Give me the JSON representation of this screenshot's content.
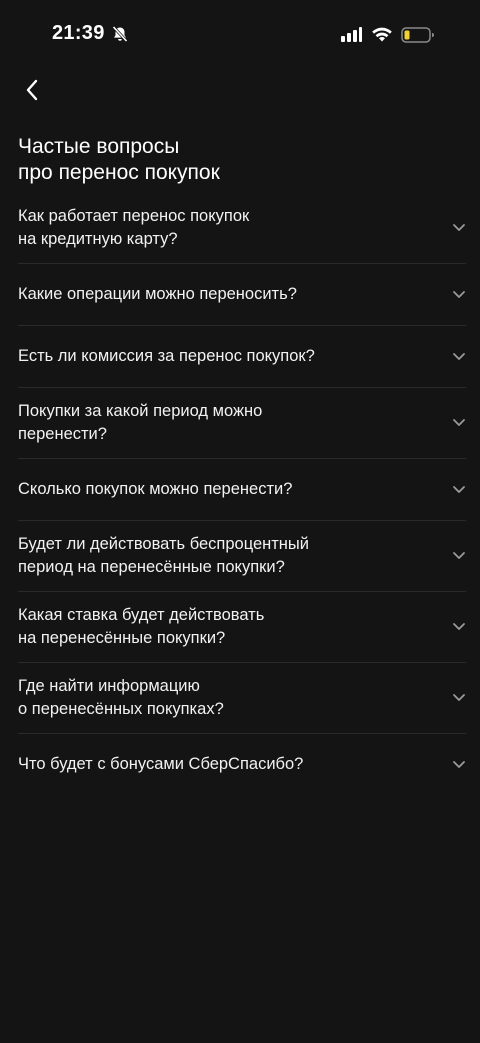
{
  "status_bar": {
    "time": "21:39"
  },
  "header": {
    "title": "Частые вопросы\nпро перенос покупок"
  },
  "faq": {
    "items": [
      {
        "question": "Как работает перенос покупок\nна кредитную карту?",
        "lines": 2
      },
      {
        "question": "Какие операции можно переносить?",
        "lines": 1
      },
      {
        "question": "Есть ли комиссия за перенос покупок?",
        "lines": 1
      },
      {
        "question": "Покупки за какой период можно\nперенести?",
        "lines": 2
      },
      {
        "question": "Сколько покупок можно перенести?",
        "lines": 1
      },
      {
        "question": "Будет ли действовать беспроцентный\nпериод на перенесённые покупки?",
        "lines": 2
      },
      {
        "question": "Какая ставка будет действовать\nна перенесённые покупки?",
        "lines": 2
      },
      {
        "question": "Где найти информацию\nо перенесённых покупках?",
        "lines": 2
      },
      {
        "question": "Что будет с бонусами СберСпасибо?",
        "lines": 1
      }
    ]
  },
  "colors": {
    "background": "#141414",
    "text": "#ffffff",
    "divider": "#2a2a2a",
    "chevron": "#9a9a9a",
    "battery_level": "#f2d230"
  },
  "icons": {
    "back": "chevron-left-icon",
    "expand": "chevron-down-icon",
    "notifications_muted": "bell-slash-icon",
    "signal": "signal-icon",
    "wifi": "wifi-icon",
    "battery": "battery-icon"
  }
}
